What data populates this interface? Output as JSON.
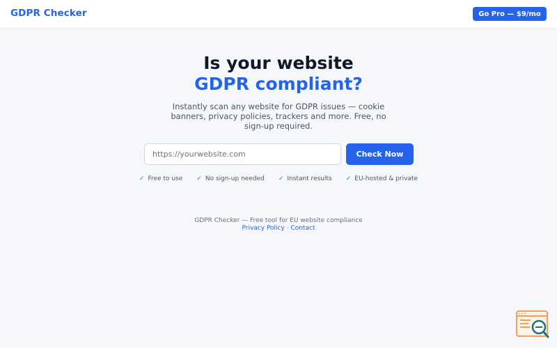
{
  "header": {
    "brand": "GDPR Checker",
    "pro_button": "Go Pro — $9/mo"
  },
  "hero": {
    "title_line1": "Is your website",
    "title_line2": "GDPR compliant?",
    "subtitle": "Instantly scan any website for GDPR issues — cookie banners, privacy policies, trackers and more. Free, no sign-up required."
  },
  "form": {
    "url_placeholder": "https://yourwebsite.com",
    "url_value": "",
    "submit_label": "Check Now"
  },
  "features": [
    {
      "icon": "check-icon",
      "label": "Free to use"
    },
    {
      "icon": "check-icon",
      "label": "No sign-up needed"
    },
    {
      "icon": "check-icon",
      "label": "Instant results"
    },
    {
      "icon": "check-icon",
      "label": "EU-hosted & private"
    }
  ],
  "footer": {
    "tagline": "GDPR Checker — Free tool for EU website compliance",
    "privacy_link": "Privacy Policy",
    "separator": "·",
    "contact_link": "Contact"
  },
  "colors": {
    "accent": "#2563eb",
    "check": "#16a34a",
    "background": "#f5f7fb",
    "widget_orange": "#f59e5a",
    "widget_teal": "#1f6f78"
  }
}
